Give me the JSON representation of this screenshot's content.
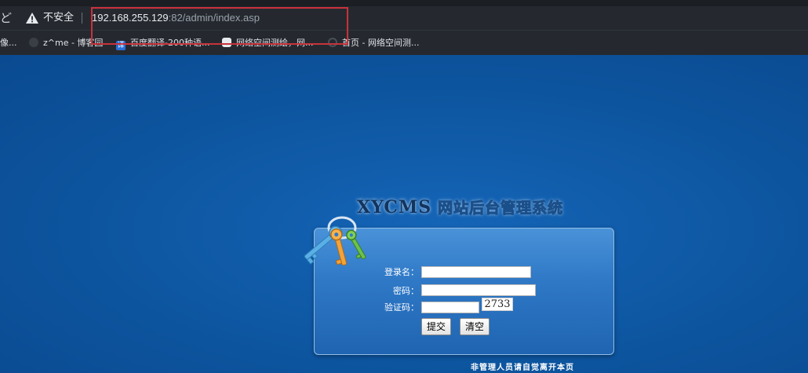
{
  "browser": {
    "back_glyph": "ど",
    "security_label": "不安全",
    "url_host": "192.168.255.129",
    "url_rest": ":82/admin/index.asp",
    "bookmarks": [
      {
        "label": "像..."
      },
      {
        "label": "z^me - 博客园"
      },
      {
        "label": "百度翻译-200种语..."
      },
      {
        "label": "网络空间测绘，网..."
      },
      {
        "label": "首页 - 网络空间测..."
      }
    ]
  },
  "page": {
    "title_en": "XYCMS",
    "title_cn": "网站后台管理系统",
    "login": {
      "username_label": "登录名：",
      "password_label": "密码：",
      "captcha_label": "验证码：",
      "username_value": "",
      "password_value": "",
      "captcha_value": "",
      "captcha_code": "2733",
      "submit_label": "提交",
      "clear_label": "清空"
    },
    "footer_note": "非管理人员请自觉离开本页"
  },
  "colors": {
    "page_background": "#0c4f9c",
    "panel": "#2f79c7",
    "url_highlight": "#c9323c"
  }
}
